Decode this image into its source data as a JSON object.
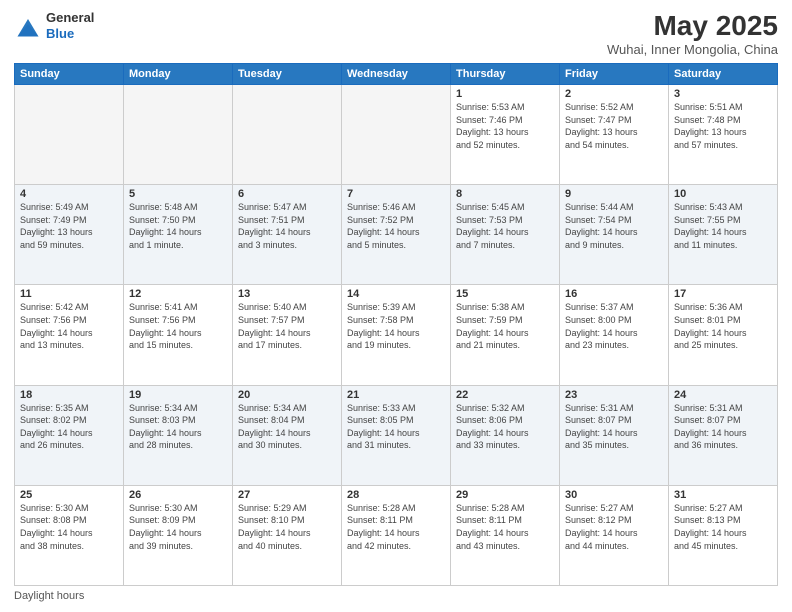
{
  "header": {
    "logo_line1": "General",
    "logo_line2": "Blue",
    "main_title": "May 2025",
    "subtitle": "Wuhai, Inner Mongolia, China"
  },
  "days_of_week": [
    "Sunday",
    "Monday",
    "Tuesday",
    "Wednesday",
    "Thursday",
    "Friday",
    "Saturday"
  ],
  "weeks": [
    [
      {
        "day": "",
        "info": ""
      },
      {
        "day": "",
        "info": ""
      },
      {
        "day": "",
        "info": ""
      },
      {
        "day": "",
        "info": ""
      },
      {
        "day": "1",
        "info": "Sunrise: 5:53 AM\nSunset: 7:46 PM\nDaylight: 13 hours\nand 52 minutes."
      },
      {
        "day": "2",
        "info": "Sunrise: 5:52 AM\nSunset: 7:47 PM\nDaylight: 13 hours\nand 54 minutes."
      },
      {
        "day": "3",
        "info": "Sunrise: 5:51 AM\nSunset: 7:48 PM\nDaylight: 13 hours\nand 57 minutes."
      }
    ],
    [
      {
        "day": "4",
        "info": "Sunrise: 5:49 AM\nSunset: 7:49 PM\nDaylight: 13 hours\nand 59 minutes."
      },
      {
        "day": "5",
        "info": "Sunrise: 5:48 AM\nSunset: 7:50 PM\nDaylight: 14 hours\nand 1 minute."
      },
      {
        "day": "6",
        "info": "Sunrise: 5:47 AM\nSunset: 7:51 PM\nDaylight: 14 hours\nand 3 minutes."
      },
      {
        "day": "7",
        "info": "Sunrise: 5:46 AM\nSunset: 7:52 PM\nDaylight: 14 hours\nand 5 minutes."
      },
      {
        "day": "8",
        "info": "Sunrise: 5:45 AM\nSunset: 7:53 PM\nDaylight: 14 hours\nand 7 minutes."
      },
      {
        "day": "9",
        "info": "Sunrise: 5:44 AM\nSunset: 7:54 PM\nDaylight: 14 hours\nand 9 minutes."
      },
      {
        "day": "10",
        "info": "Sunrise: 5:43 AM\nSunset: 7:55 PM\nDaylight: 14 hours\nand 11 minutes."
      }
    ],
    [
      {
        "day": "11",
        "info": "Sunrise: 5:42 AM\nSunset: 7:56 PM\nDaylight: 14 hours\nand 13 minutes."
      },
      {
        "day": "12",
        "info": "Sunrise: 5:41 AM\nSunset: 7:56 PM\nDaylight: 14 hours\nand 15 minutes."
      },
      {
        "day": "13",
        "info": "Sunrise: 5:40 AM\nSunset: 7:57 PM\nDaylight: 14 hours\nand 17 minutes."
      },
      {
        "day": "14",
        "info": "Sunrise: 5:39 AM\nSunset: 7:58 PM\nDaylight: 14 hours\nand 19 minutes."
      },
      {
        "day": "15",
        "info": "Sunrise: 5:38 AM\nSunset: 7:59 PM\nDaylight: 14 hours\nand 21 minutes."
      },
      {
        "day": "16",
        "info": "Sunrise: 5:37 AM\nSunset: 8:00 PM\nDaylight: 14 hours\nand 23 minutes."
      },
      {
        "day": "17",
        "info": "Sunrise: 5:36 AM\nSunset: 8:01 PM\nDaylight: 14 hours\nand 25 minutes."
      }
    ],
    [
      {
        "day": "18",
        "info": "Sunrise: 5:35 AM\nSunset: 8:02 PM\nDaylight: 14 hours\nand 26 minutes."
      },
      {
        "day": "19",
        "info": "Sunrise: 5:34 AM\nSunset: 8:03 PM\nDaylight: 14 hours\nand 28 minutes."
      },
      {
        "day": "20",
        "info": "Sunrise: 5:34 AM\nSunset: 8:04 PM\nDaylight: 14 hours\nand 30 minutes."
      },
      {
        "day": "21",
        "info": "Sunrise: 5:33 AM\nSunset: 8:05 PM\nDaylight: 14 hours\nand 31 minutes."
      },
      {
        "day": "22",
        "info": "Sunrise: 5:32 AM\nSunset: 8:06 PM\nDaylight: 14 hours\nand 33 minutes."
      },
      {
        "day": "23",
        "info": "Sunrise: 5:31 AM\nSunset: 8:07 PM\nDaylight: 14 hours\nand 35 minutes."
      },
      {
        "day": "24",
        "info": "Sunrise: 5:31 AM\nSunset: 8:07 PM\nDaylight: 14 hours\nand 36 minutes."
      }
    ],
    [
      {
        "day": "25",
        "info": "Sunrise: 5:30 AM\nSunset: 8:08 PM\nDaylight: 14 hours\nand 38 minutes."
      },
      {
        "day": "26",
        "info": "Sunrise: 5:30 AM\nSunset: 8:09 PM\nDaylight: 14 hours\nand 39 minutes."
      },
      {
        "day": "27",
        "info": "Sunrise: 5:29 AM\nSunset: 8:10 PM\nDaylight: 14 hours\nand 40 minutes."
      },
      {
        "day": "28",
        "info": "Sunrise: 5:28 AM\nSunset: 8:11 PM\nDaylight: 14 hours\nand 42 minutes."
      },
      {
        "day": "29",
        "info": "Sunrise: 5:28 AM\nSunset: 8:11 PM\nDaylight: 14 hours\nand 43 minutes."
      },
      {
        "day": "30",
        "info": "Sunrise: 5:27 AM\nSunset: 8:12 PM\nDaylight: 14 hours\nand 44 minutes."
      },
      {
        "day": "31",
        "info": "Sunrise: 5:27 AM\nSunset: 8:13 PM\nDaylight: 14 hours\nand 45 minutes."
      }
    ]
  ],
  "footer": {
    "daylight_label": "Daylight hours"
  },
  "colors": {
    "header_bg": "#2878c0",
    "accent": "#1a6bbd"
  }
}
